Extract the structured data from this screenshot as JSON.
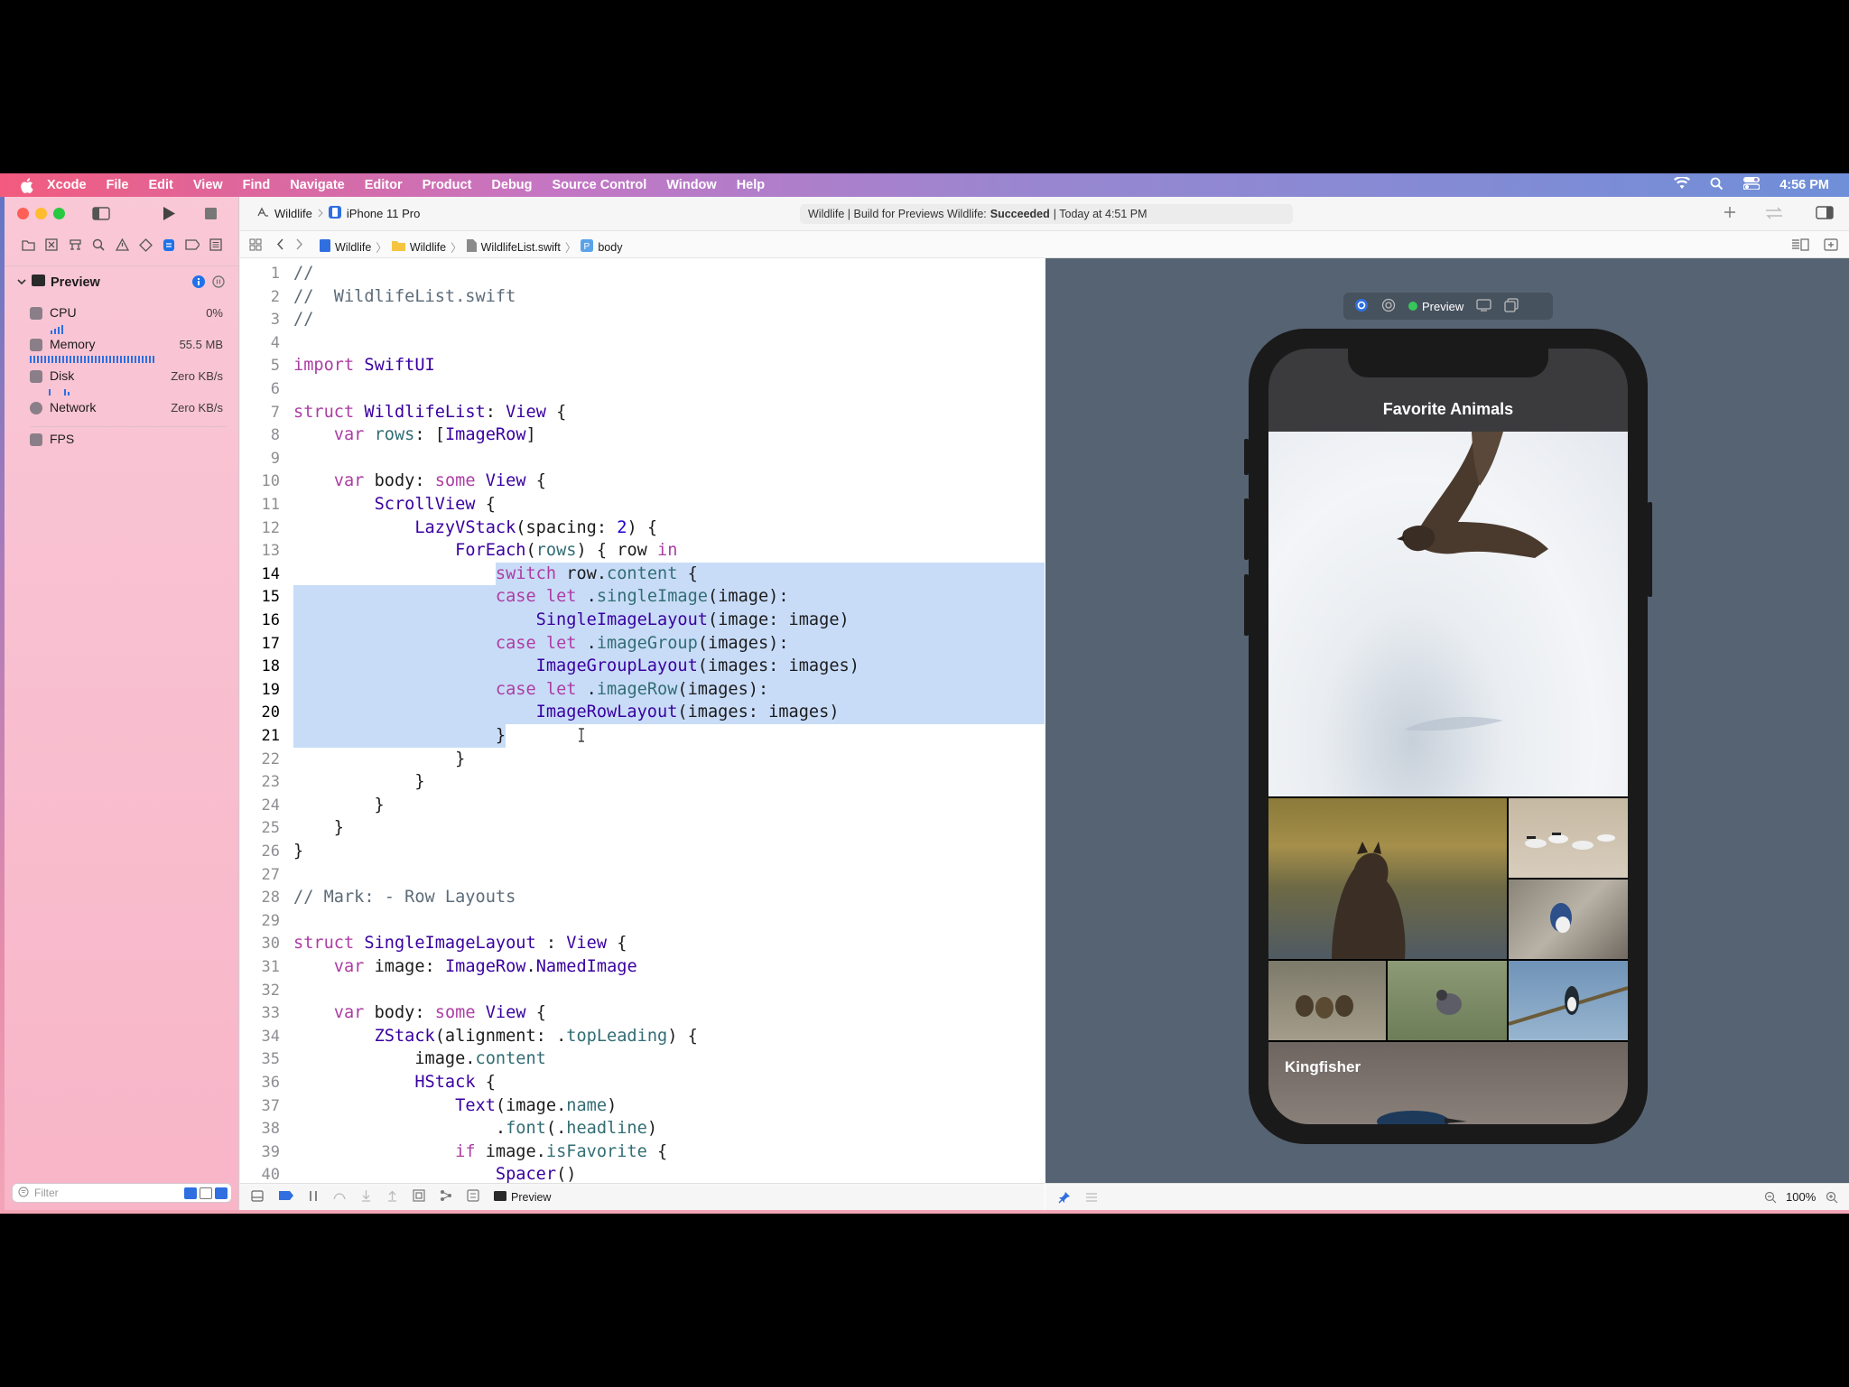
{
  "menubar": {
    "app_name": "Xcode",
    "items": [
      "File",
      "Edit",
      "View",
      "Find",
      "Navigate",
      "Editor",
      "Product",
      "Debug",
      "Source Control",
      "Window",
      "Help"
    ],
    "clock": "4:56 PM"
  },
  "toolbar": {
    "scheme": "Wildlife",
    "destination": "iPhone 11 Pro",
    "activity_prefix": "Wildlife | Build for Previews Wildlife:",
    "activity_status": "Succeeded",
    "activity_time": "| Today at 4:51 PM"
  },
  "jumpbar": {
    "crumbs": [
      "Wildlife",
      "Wildlife",
      "WildlifeList.swift",
      "body"
    ]
  },
  "sidebar": {
    "section_title": "Preview",
    "gauges": [
      {
        "name": "CPU",
        "value": "0%"
      },
      {
        "name": "Memory",
        "value": "55.5 MB"
      },
      {
        "name": "Disk",
        "value": "Zero KB/s"
      },
      {
        "name": "Network",
        "value": "Zero KB/s"
      },
      {
        "name": "FPS",
        "value": ""
      }
    ],
    "filter_placeholder": "Filter"
  },
  "code": {
    "lines": [
      {
        "n": "1",
        "t": "//"
      },
      {
        "n": "2",
        "t": "//  WildlifeList.swift"
      },
      {
        "n": "3",
        "t": "//"
      },
      {
        "n": "4",
        "t": ""
      },
      {
        "n": "5",
        "t": "import SwiftUI"
      },
      {
        "n": "6",
        "t": ""
      },
      {
        "n": "7",
        "t": "struct WildlifeList: View {"
      },
      {
        "n": "8",
        "t": "    var rows: [ImageRow]"
      },
      {
        "n": "9",
        "t": ""
      },
      {
        "n": "10",
        "t": "    var body: some View {"
      },
      {
        "n": "11",
        "t": "        ScrollView {"
      },
      {
        "n": "12",
        "t": "            LazyVStack(spacing: 2) {"
      },
      {
        "n": "13",
        "t": "                ForEach(rows) { row in"
      },
      {
        "n": "14",
        "t": "                    switch row.content {"
      },
      {
        "n": "15",
        "t": "                    case let .singleImage(image):"
      },
      {
        "n": "16",
        "t": "                        SingleImageLayout(image: image)"
      },
      {
        "n": "17",
        "t": "                    case let .imageGroup(images):"
      },
      {
        "n": "18",
        "t": "                        ImageGroupLayout(images: images)"
      },
      {
        "n": "19",
        "t": "                    case let .imageRow(images):"
      },
      {
        "n": "20",
        "t": "                        ImageRowLayout(images: images)"
      },
      {
        "n": "21",
        "t": "                    }"
      },
      {
        "n": "22",
        "t": "                }"
      },
      {
        "n": "23",
        "t": "            }"
      },
      {
        "n": "24",
        "t": "        }"
      },
      {
        "n": "25",
        "t": "    }"
      },
      {
        "n": "26",
        "t": "}"
      },
      {
        "n": "27",
        "t": ""
      },
      {
        "n": "28",
        "t": "// Mark: - Row Layouts"
      },
      {
        "n": "29",
        "t": ""
      },
      {
        "n": "30",
        "t": "struct SingleImageLayout : View {"
      },
      {
        "n": "31",
        "t": "    var image: ImageRow.NamedImage"
      },
      {
        "n": "32",
        "t": ""
      },
      {
        "n": "33",
        "t": "    var body: some View {"
      },
      {
        "n": "34",
        "t": "        ZStack(alignment: .topLeading) {"
      },
      {
        "n": "35",
        "t": "            image.content"
      },
      {
        "n": "36",
        "t": "            HStack {"
      },
      {
        "n": "37",
        "t": "                Text(image.name)"
      },
      {
        "n": "38",
        "t": "                    .font(.headline)"
      },
      {
        "n": "39",
        "t": "                if image.isFavorite {"
      },
      {
        "n": "40",
        "t": "                    Spacer()"
      }
    ],
    "highlighted_from": 14,
    "highlighted_to": 21
  },
  "canvas": {
    "preview_label": "Preview",
    "nav_title": "Favorite Animals",
    "caption": "Kingfisher",
    "zoom": "100%"
  },
  "debugbar": {
    "target": "Preview"
  }
}
